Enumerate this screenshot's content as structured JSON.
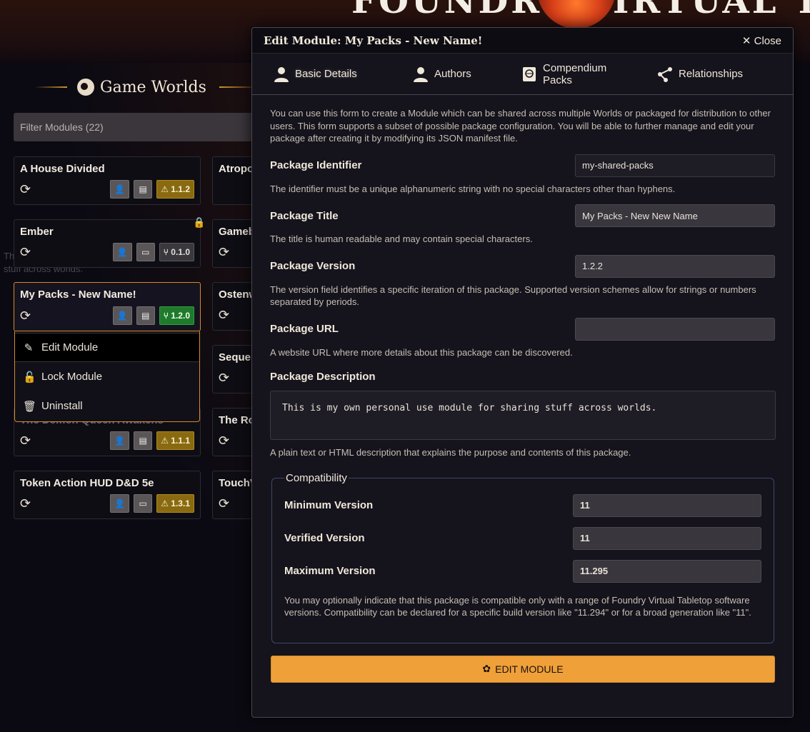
{
  "banner": {
    "title": "FOUNDRY VIRTUAL TABLETOP"
  },
  "worlds": {
    "title": "Game Worlds",
    "filter_placeholder": "Filter Modules (22)",
    "ghost_text": "This is my own personal use module for sharing stuff across worlds.",
    "cards": [
      {
        "title": "A House Divided",
        "version": "1.1.2"
      },
      {
        "title": "Atropos"
      },
      {
        "title": "Ember",
        "version": "0.1.0"
      },
      {
        "title": "Gameboard"
      },
      {
        "title": "My Packs - New Name!",
        "version": "1.2.0"
      },
      {
        "title": "Ostenwold"
      },
      {
        "title": "Sequencer"
      },
      {
        "title": "The Demon Queen Awakens",
        "version": "1.1.1"
      },
      {
        "title": "The Ronin"
      },
      {
        "title": "Token Action HUD D&D 5e",
        "version": "1.3.1"
      },
      {
        "title": "TouchVTT"
      }
    ],
    "context_menu": [
      {
        "label": "Edit Module"
      },
      {
        "label": "Lock Module"
      },
      {
        "label": "Uninstall"
      }
    ]
  },
  "modal": {
    "title": "Edit Module: My Packs - New Name!",
    "close_label": "Close",
    "tabs": [
      "Basic Details",
      "Authors",
      "Compendium Packs",
      "Relationships"
    ],
    "intro": "You can use this form to create a Module which can be shared across multiple Worlds or packaged for distribution to other users. This form supports a subset of possible package configuration. You will be able to further manage and edit your package after creating it by modifying its JSON manifest file.",
    "fields": {
      "id": {
        "label": "Package Identifier",
        "value": "my-shared-packs",
        "hint": "The identifier must be a unique alphanumeric string with no special characters other than hyphens."
      },
      "title": {
        "label": "Package Title",
        "value": "My Packs - New New Name",
        "hint": "The title is human readable and may contain special characters."
      },
      "version": {
        "label": "Package Version",
        "value": "1.2.2",
        "hint": "The version field identifies a specific iteration of this package. Supported version schemes allow for strings or numbers separated by periods."
      },
      "url": {
        "label": "Package URL",
        "value": "",
        "hint": "A website URL where more details about this package can be discovered."
      },
      "description": {
        "label": "Package Description",
        "value": "This is my own personal use module for sharing stuff across worlds.",
        "hint": "A plain text or HTML description that explains the purpose and contents of this package."
      }
    },
    "compat": {
      "legend": "Compatibility",
      "minimum": {
        "label": "Minimum Version",
        "value": "11"
      },
      "verified": {
        "label": "Verified Version",
        "value": "11"
      },
      "maximum": {
        "label": "Maximum Version",
        "value": "11.295"
      },
      "hint": "You may optionally indicate that this package is compatible only with a range of Foundry Virtual Tabletop software versions. Compatibility can be declared for a specific build version like \"11.294\" or for a broad generation like \"11\"."
    },
    "submit_label": "EDIT MODULE"
  }
}
